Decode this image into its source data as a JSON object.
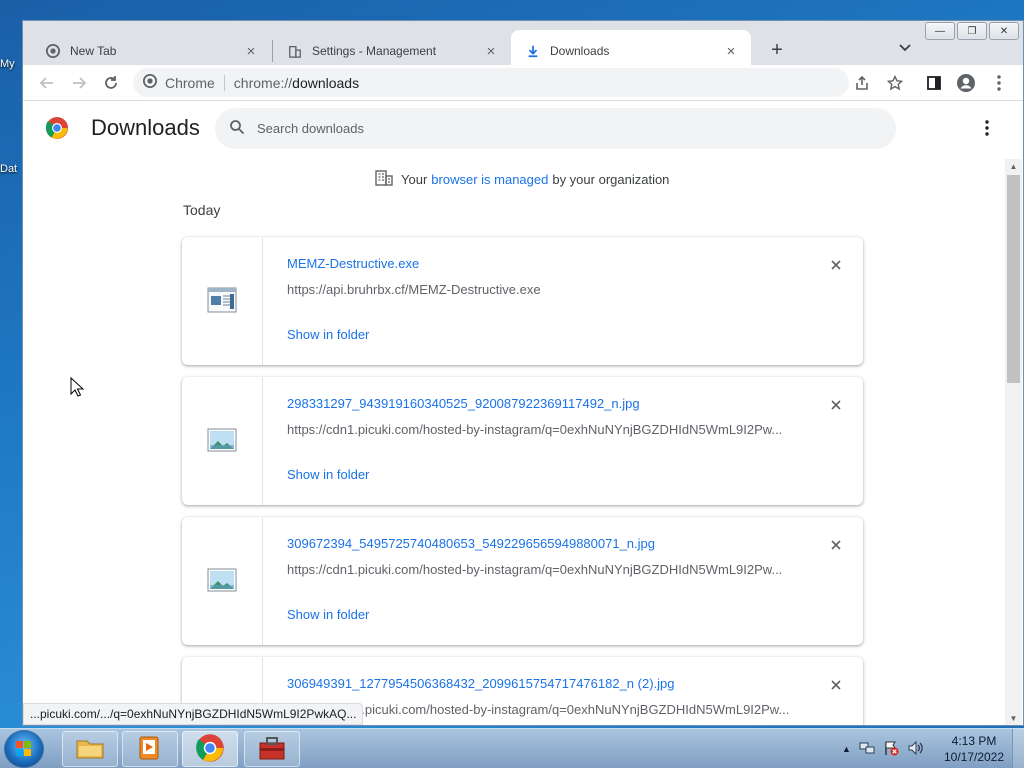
{
  "desktop": {
    "fragments": [
      "My",
      "Dat"
    ]
  },
  "window_controls": {
    "minimize": "—",
    "restore": "❐",
    "close": "✕"
  },
  "tabs": [
    {
      "label": "New Tab"
    },
    {
      "label": "Settings - Management"
    },
    {
      "label": "Downloads"
    }
  ],
  "toolbar": {
    "site_label": "Chrome",
    "url_scheme": "chrome://",
    "url_path": "downloads"
  },
  "page": {
    "title": "Downloads",
    "search_placeholder": "Search downloads",
    "managed_prefix": "Your",
    "managed_link": "browser is managed",
    "managed_suffix": "by your organization",
    "section": "Today"
  },
  "downloads": [
    {
      "filename": "MEMZ-Destructive.exe",
      "url": "https://api.bruhrbx.cf/MEMZ-Destructive.exe",
      "action": "Show in folder",
      "file_type": "exe"
    },
    {
      "filename": "298331297_943919160340525_920087922369117492_n.jpg",
      "url": "https://cdn1.picuki.com/hosted-by-instagram/q=0exhNuNYnjBGZDHIdN5WmL9I2Pw...",
      "action": "Show in folder",
      "file_type": "image"
    },
    {
      "filename": "309672394_5495725740480653_5492296565949880071_n.jpg",
      "url": "https://cdn1.picuki.com/hosted-by-instagram/q=0exhNuNYnjBGZDHIdN5WmL9I2Pw...",
      "action": "Show in folder",
      "file_type": "image"
    },
    {
      "filename": "306949391_1277954506368432_2099615754717476182_n (2).jpg",
      "url": "1.picuki.com/hosted-by-instagram/q=0exhNuNYnjBGZDHIdN5WmL9I2Pw...",
      "action": "Show in folder",
      "file_type": "image"
    }
  ],
  "status_bar": "...picuki.com/.../q=0exhNuNYnjBGZDHIdN5WmL9I2PwkAQ...",
  "clock": {
    "time": "4:13 PM",
    "date": "10/17/2022"
  },
  "colors": {
    "link": "#1a73e8",
    "tab_strip": "#dee1e6",
    "taskbar": "#8fb0d3"
  }
}
